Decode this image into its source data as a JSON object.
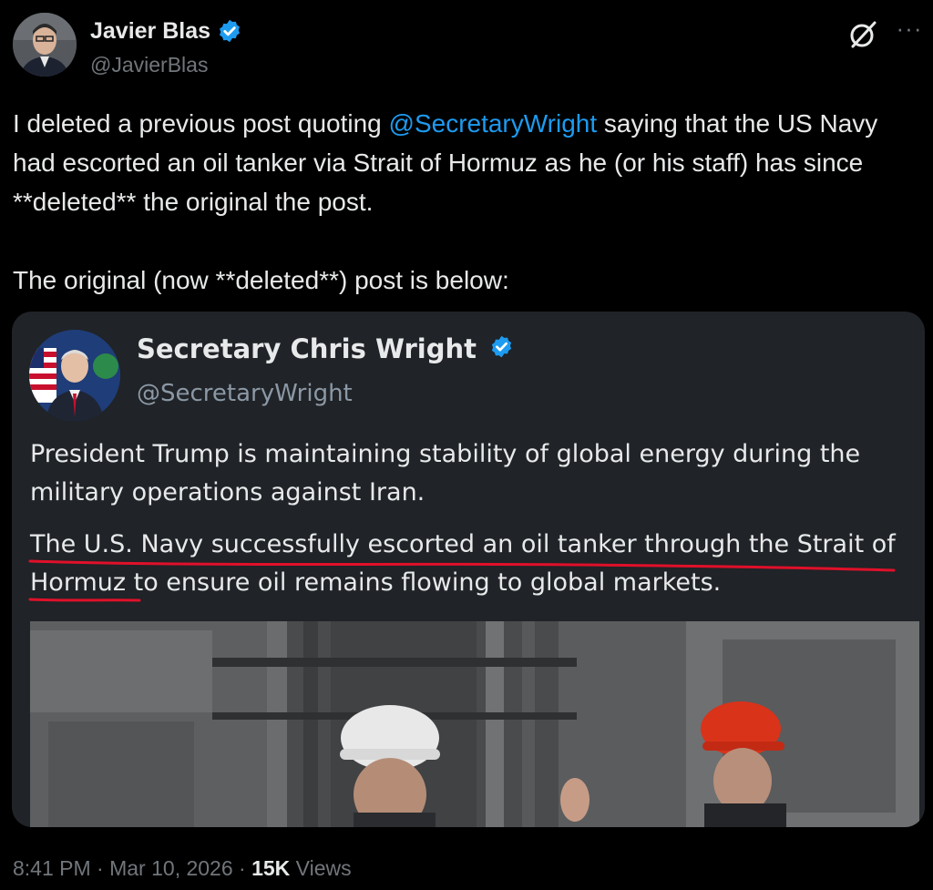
{
  "author": {
    "name": "Javier Blas",
    "handle": "@JavierBlas"
  },
  "post": {
    "text_pre": "I deleted a previous post quoting ",
    "mention": "@SecretaryWright",
    "text_post": " saying that the US Navy had escorted an oil tanker via Strait of Hormuz as he (or his staff) has since **deleted** the original the post.",
    "text_line2": "The original (now **deleted**) post is below:"
  },
  "quote": {
    "name": "Secretary Chris Wright",
    "handle": "@SecretaryWright",
    "para1": "President Trump is maintaining stability of global energy during the military operations against Iran.",
    "para2": "The U.S. Navy successfully escorted an oil tanker through the Strait of Hormuz to ensure oil remains flowing to global markets."
  },
  "meta": {
    "time": "8:41 PM",
    "separator": " · ",
    "date": "Mar 10, 2026",
    "views_count": "15K",
    "views_label": " Views"
  },
  "icons": {
    "verified": "verified-badge-icon",
    "grok": "grok-icon",
    "more": "more-icon"
  },
  "colors": {
    "accent": "#1d9bf0",
    "underline": "#e0102a",
    "background": "#000000",
    "card": "#202327"
  }
}
